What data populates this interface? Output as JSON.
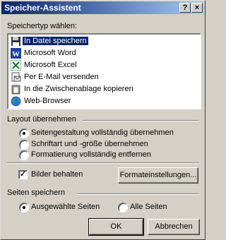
{
  "title": "Speicher-Assistent",
  "title_buttons": {
    "help": "?",
    "close": "×"
  },
  "storage_type_label": "Speichertyp wählen:",
  "storage_items": [
    {
      "label": "In Datei speichern",
      "icon": "floppy-disk-icon",
      "selected": true
    },
    {
      "label": "Microsoft Word",
      "icon": "word-icon",
      "selected": false
    },
    {
      "label": "Microsoft Excel",
      "icon": "excel-icon",
      "selected": false
    },
    {
      "label": "Per E-Mail versenden",
      "icon": "email-icon",
      "selected": false
    },
    {
      "label": "In die Zwischenablage kopieren",
      "icon": "clipboard-icon",
      "selected": false
    },
    {
      "label": "Web-Browser",
      "icon": "globe-icon",
      "selected": false
    }
  ],
  "layout_group": "Layout übernehmen",
  "layout_options": [
    {
      "label": "Seitengestaltung vollständig übernehmen",
      "checked": true
    },
    {
      "label": "Schriftart und -größe übernehmen",
      "checked": false
    },
    {
      "label": "Formatierung vollständig entfernen",
      "checked": false
    }
  ],
  "keep_images_label": "Bilder behalten",
  "keep_images_checked": true,
  "format_settings_button": "Formateinstellungen...",
  "pages_group": "Seiten speichern",
  "pages_options": [
    {
      "label": "Ausgewählte Seiten",
      "checked": true
    },
    {
      "label": "Alle Seiten",
      "checked": false
    }
  ],
  "ok_button": "OK",
  "cancel_button": "Abbrechen"
}
